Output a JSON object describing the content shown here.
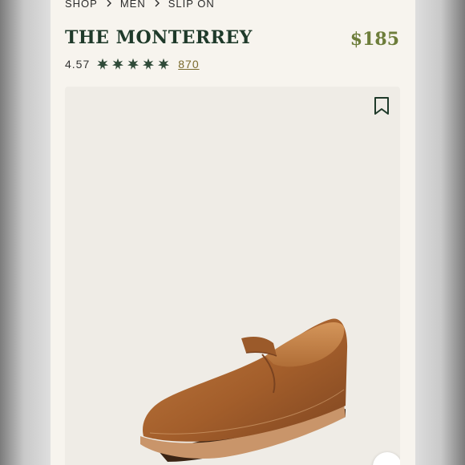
{
  "breadcrumb": {
    "items": [
      "SHOP",
      "MEN",
      "SLIP ON"
    ]
  },
  "product": {
    "title": "THE MONTERREY",
    "price": "$185"
  },
  "rating": {
    "value": "4.57",
    "stars": 5,
    "reviews_count": "870"
  },
  "colors": {
    "title": "#1f3a2a",
    "price": "#6d7d3a",
    "star": "#2f4a38",
    "link": "#7a6a2c",
    "page_bg": "#f7f4ee",
    "image_bg": "#efece6"
  },
  "icons": {
    "separator": "chevron-right-icon",
    "star": "star-icon",
    "bookmark": "bookmark-icon"
  }
}
